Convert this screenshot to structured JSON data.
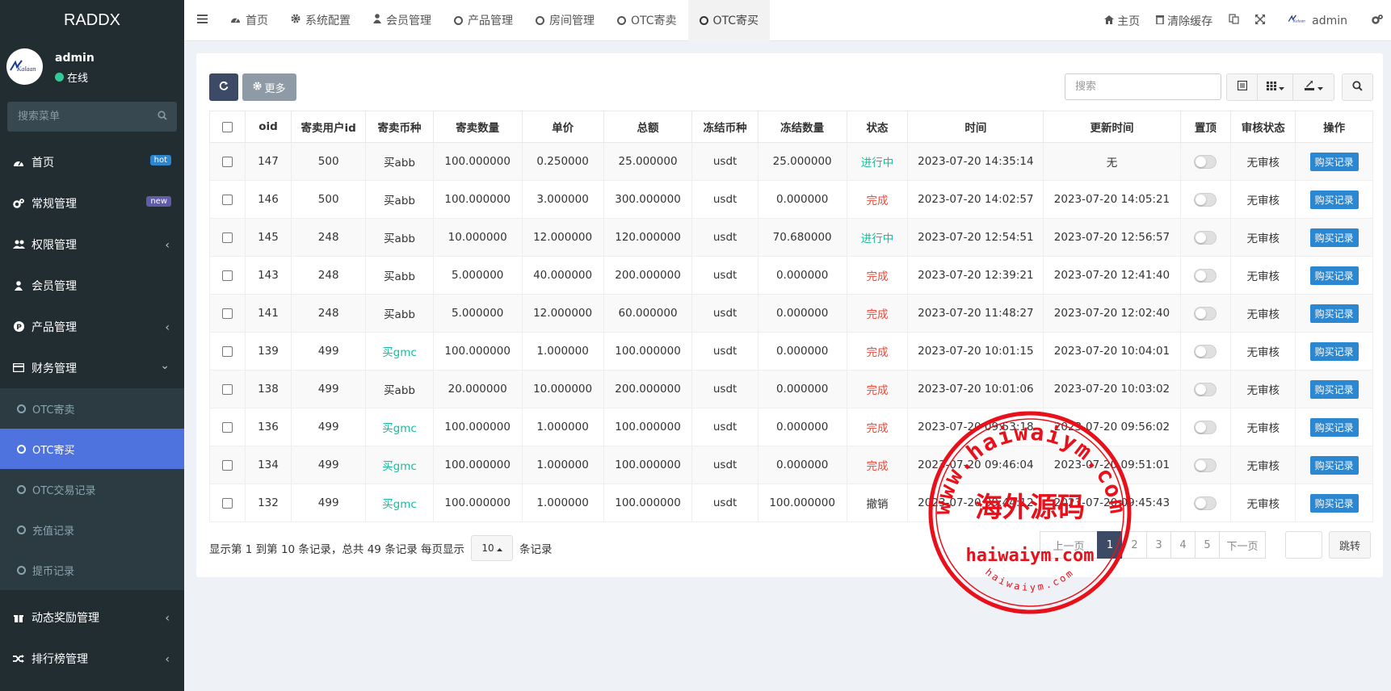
{
  "sidebar": {
    "brand": "RADDX",
    "user": {
      "name": "admin",
      "status": "在线",
      "logo_text": "Kalaan"
    },
    "search_placeholder": "搜索菜单",
    "menu": [
      {
        "label": "首页",
        "icon": "dashboard-icon",
        "badge": "hot"
      },
      {
        "label": "常规管理",
        "icon": "cogs-icon",
        "badge": "new"
      },
      {
        "label": "权限管理",
        "icon": "group-icon",
        "chevron": "‹"
      },
      {
        "label": "会员管理",
        "icon": "user-icon"
      },
      {
        "label": "产品管理",
        "icon": "product-icon",
        "chevron": "‹"
      },
      {
        "label": "财务管理",
        "icon": "credit-card-icon",
        "chevron": "⌄"
      }
    ],
    "submenu": [
      {
        "label": "OTC寄卖"
      },
      {
        "label": "OTC寄买"
      },
      {
        "label": "OTC交易记录"
      },
      {
        "label": "充值记录"
      },
      {
        "label": "提币记录"
      }
    ],
    "menu2": [
      {
        "label": "动态奖励管理",
        "icon": "gift-icon",
        "chevron": "‹"
      },
      {
        "label": "排行榜管理",
        "icon": "random-icon",
        "chevron": "‹"
      }
    ]
  },
  "topnav": {
    "tabs": [
      {
        "label": "首页"
      },
      {
        "label": "系统配置"
      },
      {
        "label": "会员管理"
      },
      {
        "label": "产品管理"
      },
      {
        "label": "房间管理"
      },
      {
        "label": "OTC寄卖"
      },
      {
        "label": "OTC寄买"
      }
    ],
    "right": {
      "home": "主页",
      "clear_cache": "清除缓存",
      "user": "admin",
      "logo_text": "Kalaan"
    }
  },
  "toolbar": {
    "more_label": "更多",
    "search_placeholder": "搜索"
  },
  "table": {
    "headers": [
      "oid",
      "寄卖用户id",
      "寄卖币种",
      "寄卖数量",
      "单价",
      "总额",
      "冻结币种",
      "冻结数量",
      "状态",
      "时间",
      "更新时间",
      "置顶",
      "审核状态",
      "操作"
    ],
    "action_label": "购买记录",
    "rows": [
      {
        "oid": "147",
        "uid": "500",
        "coin": "买abb",
        "qty": "100.000000",
        "price": "0.250000",
        "total": "25.000000",
        "fcoin": "usdt",
        "fqty": "25.000000",
        "status": "进行中",
        "time": "2023-07-20 14:35:14",
        "utime": "无",
        "audit": "无审核"
      },
      {
        "oid": "146",
        "uid": "500",
        "coin": "买abb",
        "qty": "100.000000",
        "price": "3.000000",
        "total": "300.000000",
        "fcoin": "usdt",
        "fqty": "0.000000",
        "status": "完成",
        "time": "2023-07-20 14:02:57",
        "utime": "2023-07-20 14:05:21",
        "audit": "无审核"
      },
      {
        "oid": "145",
        "uid": "248",
        "coin": "买abb",
        "qty": "10.000000",
        "price": "12.000000",
        "total": "120.000000",
        "fcoin": "usdt",
        "fqty": "70.680000",
        "status": "进行中",
        "time": "2023-07-20 12:54:51",
        "utime": "2023-07-20 12:56:57",
        "audit": "无审核"
      },
      {
        "oid": "143",
        "uid": "248",
        "coin": "买abb",
        "qty": "5.000000",
        "price": "40.000000",
        "total": "200.000000",
        "fcoin": "usdt",
        "fqty": "0.000000",
        "status": "完成",
        "time": "2023-07-20 12:39:21",
        "utime": "2023-07-20 12:41:40",
        "audit": "无审核"
      },
      {
        "oid": "141",
        "uid": "248",
        "coin": "买abb",
        "qty": "5.000000",
        "price": "12.000000",
        "total": "60.000000",
        "fcoin": "usdt",
        "fqty": "0.000000",
        "status": "完成",
        "time": "2023-07-20 11:48:27",
        "utime": "2023-07-20 12:02:40",
        "audit": "无审核"
      },
      {
        "oid": "139",
        "uid": "499",
        "coin": "买gmc",
        "qty": "100.000000",
        "price": "1.000000",
        "total": "100.000000",
        "fcoin": "usdt",
        "fqty": "0.000000",
        "status": "完成",
        "time": "2023-07-20 10:01:15",
        "utime": "2023-07-20 10:04:01",
        "audit": "无审核"
      },
      {
        "oid": "138",
        "uid": "499",
        "coin": "买abb",
        "qty": "20.000000",
        "price": "10.000000",
        "total": "200.000000",
        "fcoin": "usdt",
        "fqty": "0.000000",
        "status": "完成",
        "time": "2023-07-20 10:01:06",
        "utime": "2023-07-20 10:03:02",
        "audit": "无审核"
      },
      {
        "oid": "136",
        "uid": "499",
        "coin": "买gmc",
        "qty": "100.000000",
        "price": "1.000000",
        "total": "100.000000",
        "fcoin": "usdt",
        "fqty": "0.000000",
        "status": "完成",
        "time": "2023-07-20 09:53:18",
        "utime": "2023-07-20 09:56:02",
        "audit": "无审核"
      },
      {
        "oid": "134",
        "uid": "499",
        "coin": "买gmc",
        "qty": "100.000000",
        "price": "1.000000",
        "total": "100.000000",
        "fcoin": "usdt",
        "fqty": "0.000000",
        "status": "完成",
        "time": "2023-07-20 09:46:04",
        "utime": "2023-07-20 09:51:01",
        "audit": "无审核"
      },
      {
        "oid": "132",
        "uid": "499",
        "coin": "买gmc",
        "qty": "100.000000",
        "price": "1.000000",
        "total": "100.000000",
        "fcoin": "usdt",
        "fqty": "100.000000",
        "status": "撤销",
        "time": "2023-07-20 09:44:12",
        "utime": "2023-07-20 09:45:43",
        "audit": "无审核"
      }
    ]
  },
  "pagination": {
    "info_prefix": "显示第 1 到第 10 条记录，总共 49 条记录 每页显示",
    "page_size": "10",
    "info_suffix": "条记录",
    "prev": "上一页",
    "next": "下一页",
    "pages": [
      "1",
      "2",
      "3",
      "4",
      "5"
    ],
    "current": "1",
    "jump": "跳转"
  },
  "watermark": {
    "top_arc": "www.haiwaiym.com",
    "center": "海外源码",
    "domain": "haiwaiym.com",
    "bottom_arc": "haiwaiym.com",
    "color": "#e8101a"
  },
  "colors": {
    "sidebar_bg": "#222d32",
    "active_sub": "#4e73df",
    "primary": "#2c87d1",
    "success": "#18bc9c",
    "danger": "#e74c3c"
  }
}
